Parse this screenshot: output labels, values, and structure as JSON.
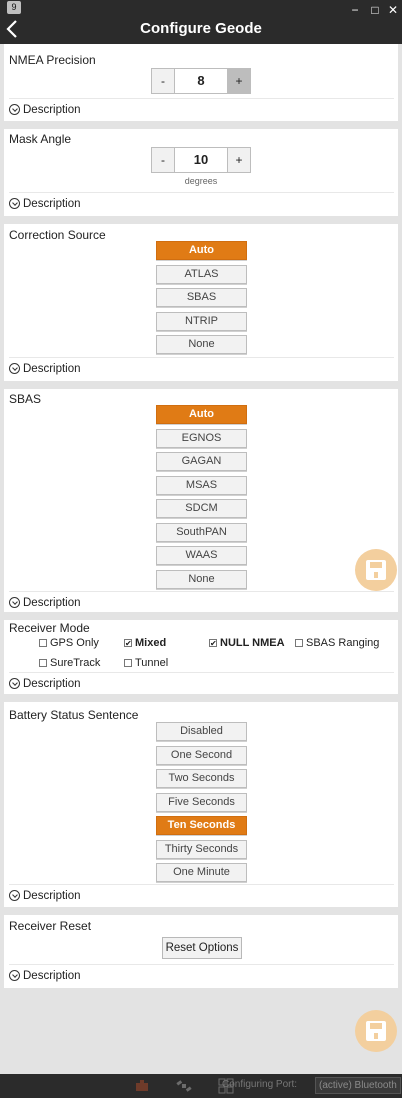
{
  "app": {
    "badge": "9",
    "title": "Configure Geode"
  },
  "window": {
    "minimize": "−",
    "maximize": "□",
    "close": "✕"
  },
  "description_label": "Description",
  "nmea_precision": {
    "label": "NMEA Precision",
    "value": "8",
    "minus": "-",
    "plus": "+"
  },
  "mask_angle": {
    "label": "Mask Angle",
    "value": "10",
    "unit": "degrees",
    "minus": "-",
    "plus": "+"
  },
  "correction_source": {
    "label": "Correction Source",
    "options": [
      "Auto",
      "ATLAS",
      "SBAS",
      "NTRIP",
      "None"
    ],
    "selected": "Auto"
  },
  "sbas": {
    "label": "SBAS",
    "options": [
      "Auto",
      "EGNOS",
      "GAGAN",
      "MSAS",
      "SDCM",
      "SouthPAN",
      "WAAS",
      "None"
    ],
    "selected": "Auto"
  },
  "receiver_mode": {
    "label": "Receiver Mode",
    "options": [
      {
        "label": "GPS Only",
        "checked": false
      },
      {
        "label": "Mixed",
        "checked": true
      },
      {
        "label": "NULL NMEA",
        "checked": true
      },
      {
        "label": "SBAS Ranging",
        "checked": false
      },
      {
        "label": "SureTrack",
        "checked": false
      },
      {
        "label": "Tunnel",
        "checked": false
      }
    ]
  },
  "battery_status": {
    "label": "Battery Status Sentence",
    "options": [
      "Disabled",
      "One Second",
      "Two Seconds",
      "Five Seconds",
      "Ten Seconds",
      "Thirty Seconds",
      "One Minute"
    ],
    "selected": "Ten Seconds"
  },
  "receiver_reset": {
    "label": "Receiver Reset",
    "button": "Reset Options"
  },
  "bottom_bar": {
    "port_label": "Configuring Port:",
    "port_value": "(active) Bluetooth"
  },
  "icons": {
    "save": "save-icon",
    "back": "back-arrow-icon"
  },
  "colors": {
    "accent": "#e07b15",
    "fab": "#f3cf9e",
    "titlebar": "#2b2b2b"
  }
}
